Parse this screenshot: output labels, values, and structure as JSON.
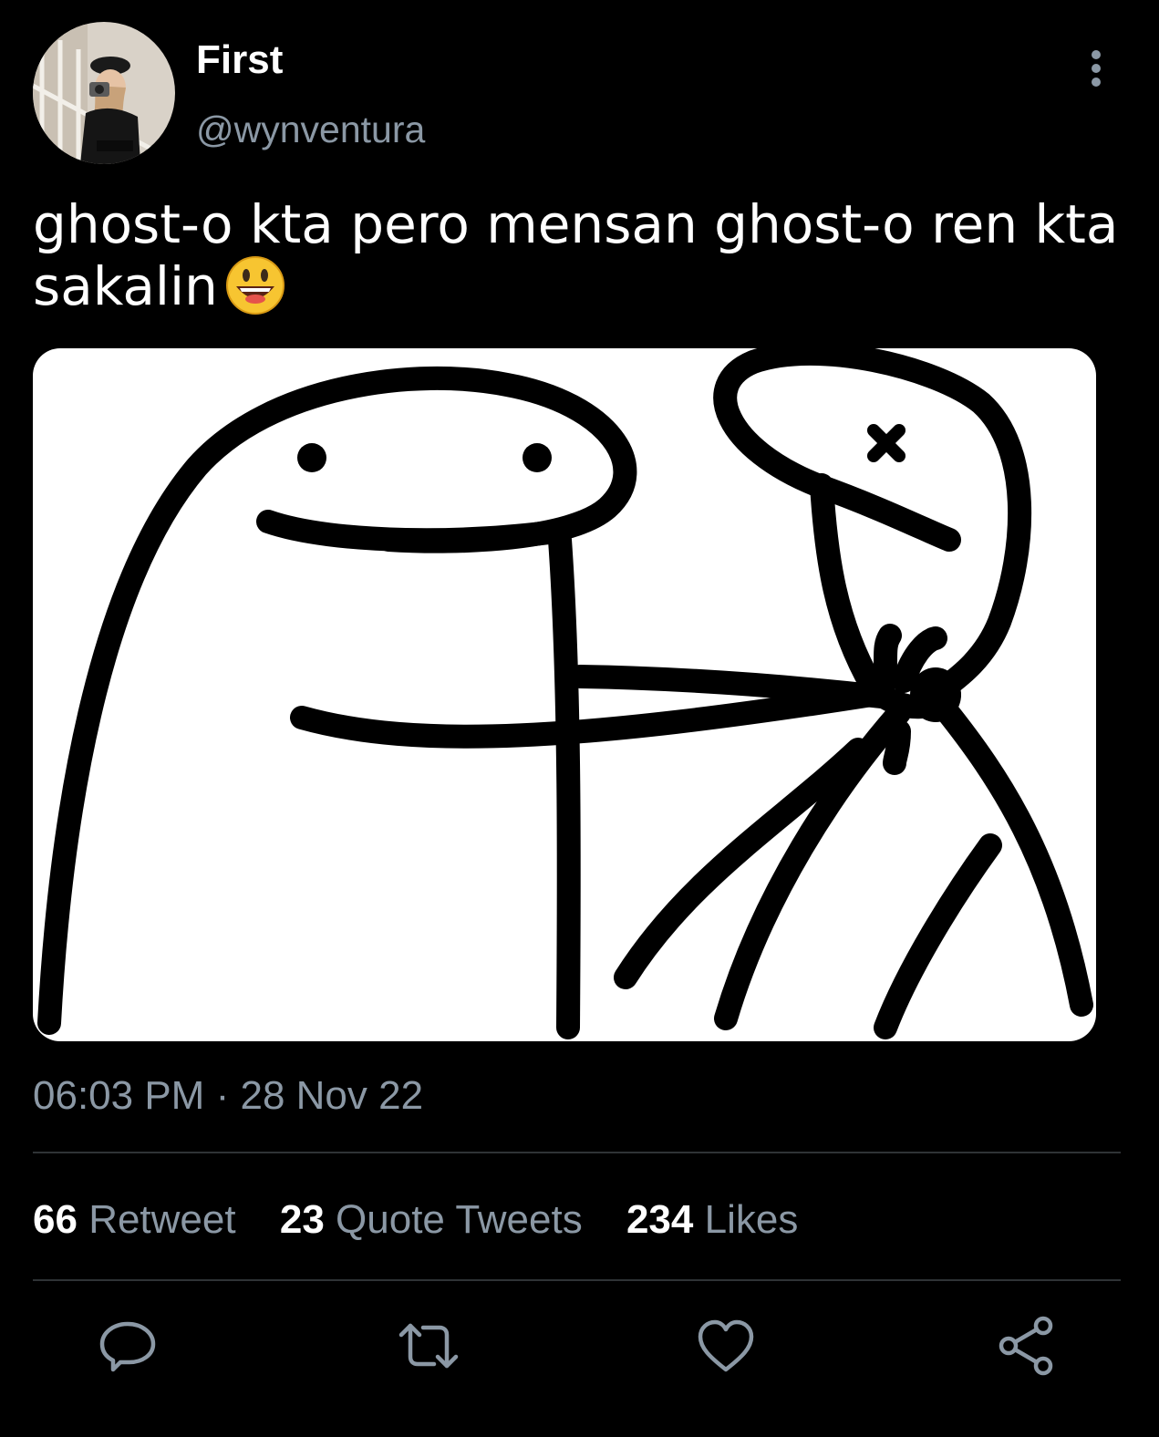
{
  "author": {
    "display_name": "First",
    "handle": "@wynventura"
  },
  "tweet": {
    "text": "ghost-o kta pero mensan ghost-o ren kta sakalin",
    "emoji": "smiling-face-with-open-mouth"
  },
  "meta": {
    "time": "06:03 PM",
    "separator": "·",
    "date": "28 Nov 22"
  },
  "stats": [
    {
      "count": "66",
      "label": "Retweet"
    },
    {
      "count": "23",
      "label": "Quote Tweets"
    },
    {
      "count": "234",
      "label": "Likes"
    }
  ],
  "actions": [
    "reply-icon",
    "retweet-icon",
    "like-icon",
    "share-icon"
  ],
  "colors": {
    "background": "#000000",
    "text": "#ffffff",
    "secondary": "#8b98a5",
    "divider": "#2f3336"
  }
}
